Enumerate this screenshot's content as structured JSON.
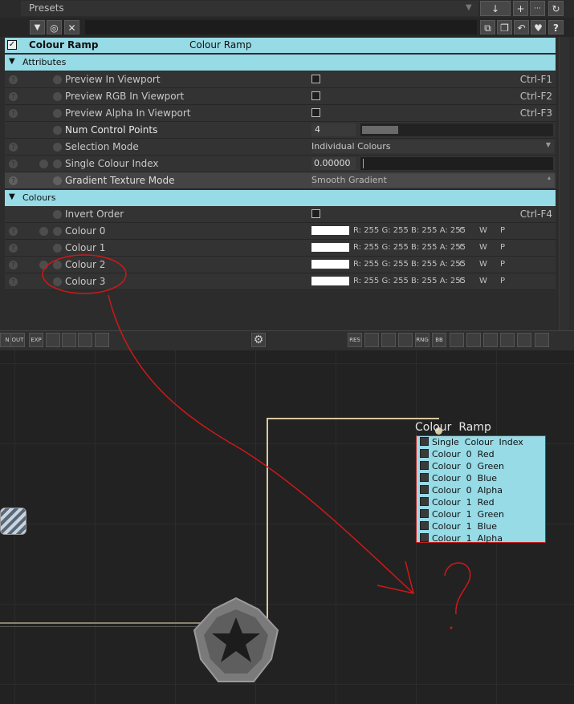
{
  "presets": {
    "label": "Presets"
  },
  "toolbar_icons": {
    "download": "↓",
    "add": "+",
    "more": "···",
    "refresh": "↻"
  },
  "filter_icons": {
    "filter": "▼",
    "target": "◎",
    "clear": "✕"
  },
  "right_icons": {
    "copy": "⧉",
    "paste": "❐",
    "undo": "↶",
    "favorite": "♥",
    "help": "?"
  },
  "node": {
    "name": "Colour Ramp",
    "type": "Colour Ramp"
  },
  "sections": {
    "attributes": "Attributes",
    "colours": "Colours"
  },
  "attributes": [
    {
      "label": "Preview In Viewport",
      "shortcut": "Ctrl-F1"
    },
    {
      "label": "Preview RGB In Viewport",
      "shortcut": "Ctrl-F2"
    },
    {
      "label": "Preview Alpha In Viewport",
      "shortcut": "Ctrl-F3"
    },
    {
      "label": "Num Control Points",
      "value": "4"
    },
    {
      "label": "Selection Mode",
      "value": "Individual Colours"
    },
    {
      "label": "Single Colour Index",
      "value": "0.00000"
    },
    {
      "label": "Gradient Texture Mode",
      "value": "Smooth Gradient"
    }
  ],
  "num_control_points_fraction": 0.19,
  "colours": {
    "invert": {
      "label": "Invert Order",
      "shortcut": "Ctrl-F4"
    },
    "items": [
      {
        "label": "Colour 0",
        "rgba": "R: 255 G: 255 B: 255 A: 255"
      },
      {
        "label": "Colour 1",
        "rgba": "R: 255 G: 255 B: 255 A: 255"
      },
      {
        "label": "Colour 2",
        "rgba": "R: 255 G: 255 B: 255 A: 255"
      },
      {
        "label": "Colour 3",
        "rgba": "R: 255 G: 255 B: 255 A: 255"
      }
    ],
    "btn_c": "C",
    "btn_w": "W",
    "btn_p": "P"
  },
  "node_toolbar": {
    "left": [
      "N",
      "OUT",
      "EXP",
      "",
      "",
      "",
      ""
    ],
    "right": [
      "RES",
      "",
      "",
      "",
      "RNG",
      "BB",
      "",
      "",
      "",
      "",
      "",
      ""
    ]
  },
  "graph_node": {
    "title": "Colour  Ramp",
    "outputs": [
      "Single  Colour  Index",
      "Colour  0  Red",
      "Colour  0  Green",
      "Colour  0  Blue",
      "Colour  0  Alpha",
      "Colour  1  Red",
      "Colour  1  Green",
      "Colour  1  Blue",
      "Colour  1  Alpha"
    ]
  },
  "annotation": {
    "mark": "?"
  },
  "colors": {
    "header": "#97dbe6",
    "annotation": "#d01818",
    "wire": "#d8c8a0"
  }
}
